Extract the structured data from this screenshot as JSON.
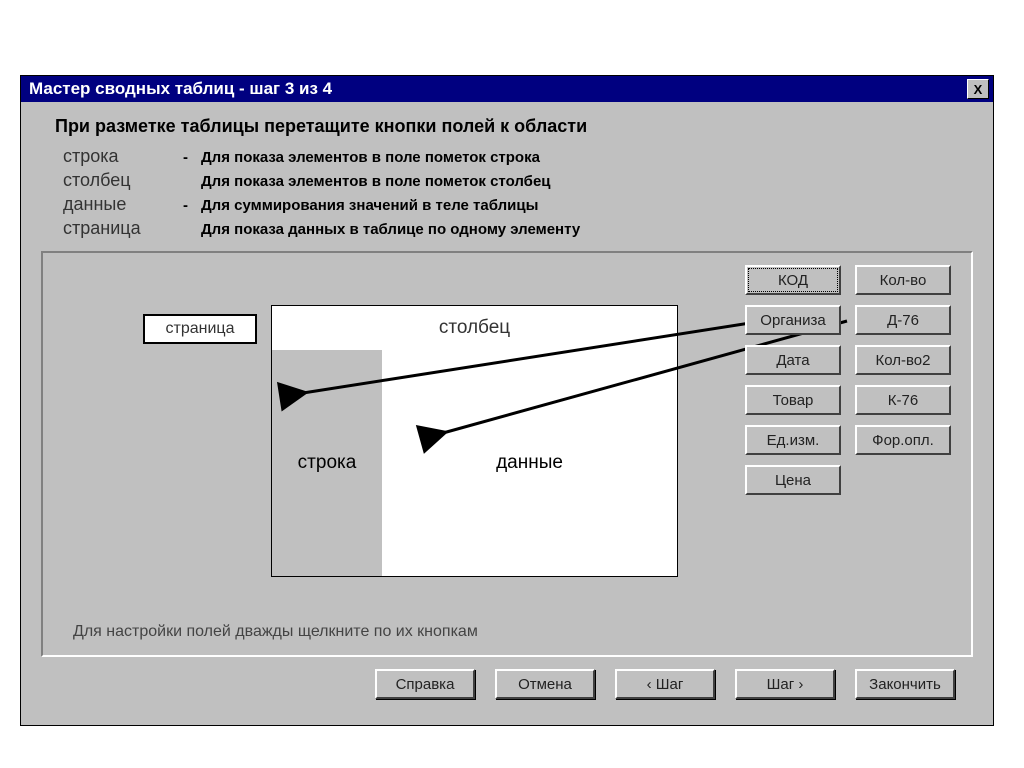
{
  "title": "Мастер сводных таблиц - шаг 3 из 4",
  "close_label": "X",
  "intro": "При разметке таблицы перетащите кнопки полей к области",
  "legend": [
    {
      "term": "строка",
      "dash": "-",
      "desc": "Для показа элементов в поле пометок строка"
    },
    {
      "term": "столбец",
      "dash": "",
      "desc": "Для показа элементов в поле пометок столбец"
    },
    {
      "term": "данные",
      "dash": "-",
      "desc": "Для суммирования значений в теле таблицы"
    },
    {
      "term": "страница",
      "dash": "",
      "desc": "Для показа данных в таблице по одному элементу"
    }
  ],
  "zones": {
    "page": "страница",
    "column": "столбец",
    "row": "строка",
    "data": "данные"
  },
  "fields_left": [
    "КОД",
    "Организа",
    "Дата",
    "Товар",
    "Ед.изм.",
    "Цена"
  ],
  "fields_right": [
    "Кол-во",
    "Д-76",
    "Кол-во2",
    "К-76",
    "Фор.опл."
  ],
  "hint": "Для настройки полей дважды щелкните по их кнопкам",
  "buttons": {
    "help": "Справка",
    "cancel": "Отмена",
    "back": "‹ Шаг",
    "next": "Шаг ›",
    "finish": "Закончить"
  }
}
